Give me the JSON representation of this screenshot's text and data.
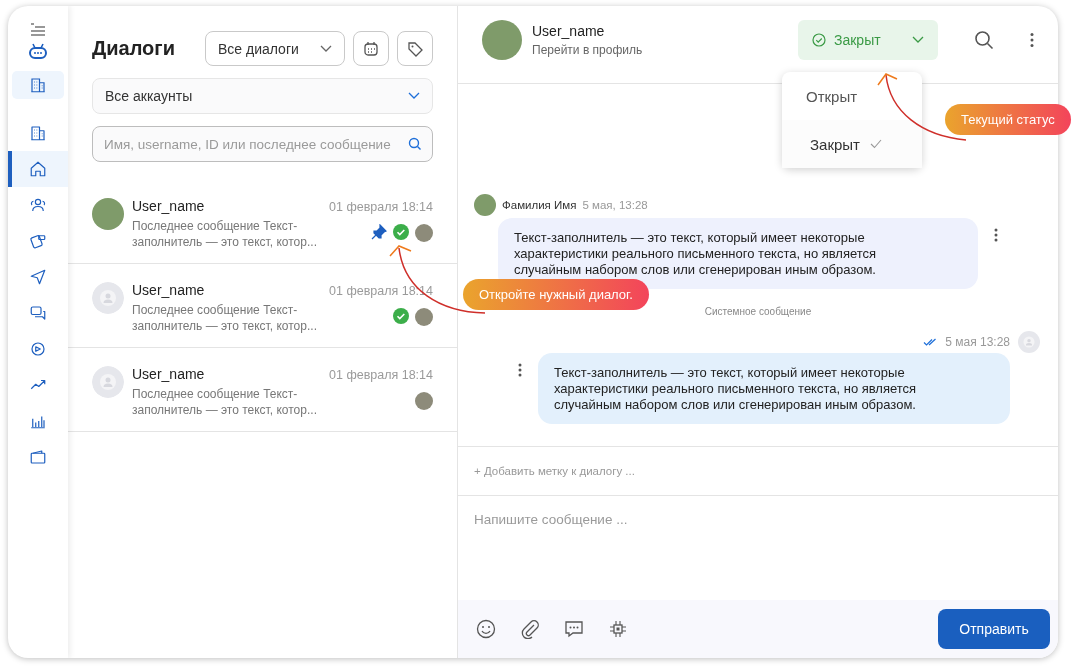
{
  "sidebar": {
    "items": [
      {
        "kind": "building",
        "selected": false
      },
      {
        "kind": "home",
        "selected": true
      },
      {
        "kind": "users",
        "selected": false
      },
      {
        "kind": "cards",
        "selected": false
      },
      {
        "kind": "send",
        "selected": false
      },
      {
        "kind": "chat",
        "selected": false
      },
      {
        "kind": "circle",
        "selected": false
      },
      {
        "kind": "trend",
        "selected": false
      },
      {
        "kind": "bars",
        "selected": false
      },
      {
        "kind": "wallet",
        "selected": false
      }
    ]
  },
  "dialogs_panel": {
    "title": "Диалоги",
    "filter": "Все диалоги",
    "accounts": "Все аккаунты",
    "search": {
      "placeholder": "Имя, username, ID или последнее сообщение"
    },
    "dialogs": [
      {
        "name": "User_name",
        "time": "01 февраля 18:14",
        "preview": "Последнее сообщение Текст-заполнитель — это текст, котор...",
        "photo": true,
        "pinned": true,
        "resolved": true
      },
      {
        "name": "User_name",
        "time": "01 февраля 18:14",
        "preview": "Последнее сообщение Текст-заполнитель — это текст, котор...",
        "photo": false,
        "pinned": false,
        "resolved": true
      },
      {
        "name": "User_name",
        "time": "01 февраля 18:14",
        "preview": "Последнее сообщение Текст-заполнитель — это текст, котор...",
        "photo": false,
        "pinned": false,
        "resolved": false
      }
    ]
  },
  "chat": {
    "user": {
      "name": "User_name",
      "link": "Перейти в профиль"
    },
    "status": "Закрыт",
    "status_menu": [
      {
        "label": "Открыт",
        "selected": false
      },
      {
        "label": "Закрыт",
        "selected": true
      }
    ],
    "messages": [
      {
        "kind": "incoming",
        "author": "Фамилия Имя",
        "time": "5 мая, 13:28",
        "text": "Текст-заполнитель — это текст, который имеет некоторые характеристики реального письменного текста, но является случайным набором слов или сгенерирован иным образом."
      },
      {
        "kind": "system",
        "text": "Системное сообщение"
      },
      {
        "kind": "outgoing",
        "time": "5 мая 13:28",
        "read": true,
        "text": "Текст-заполнитель — это текст, который имеет некоторые характеристики реального письменного текста, но является случайным набором слов или сгенерирован иным образом."
      }
    ],
    "add_tag": "+ Добавить метку к диалогу ...",
    "composer": {
      "placeholder": "Напишите сообщение ..."
    },
    "send": "Отправить"
  },
  "callouts": {
    "status": "Текущий статус",
    "dialog": "Откройте нужный диалог."
  }
}
